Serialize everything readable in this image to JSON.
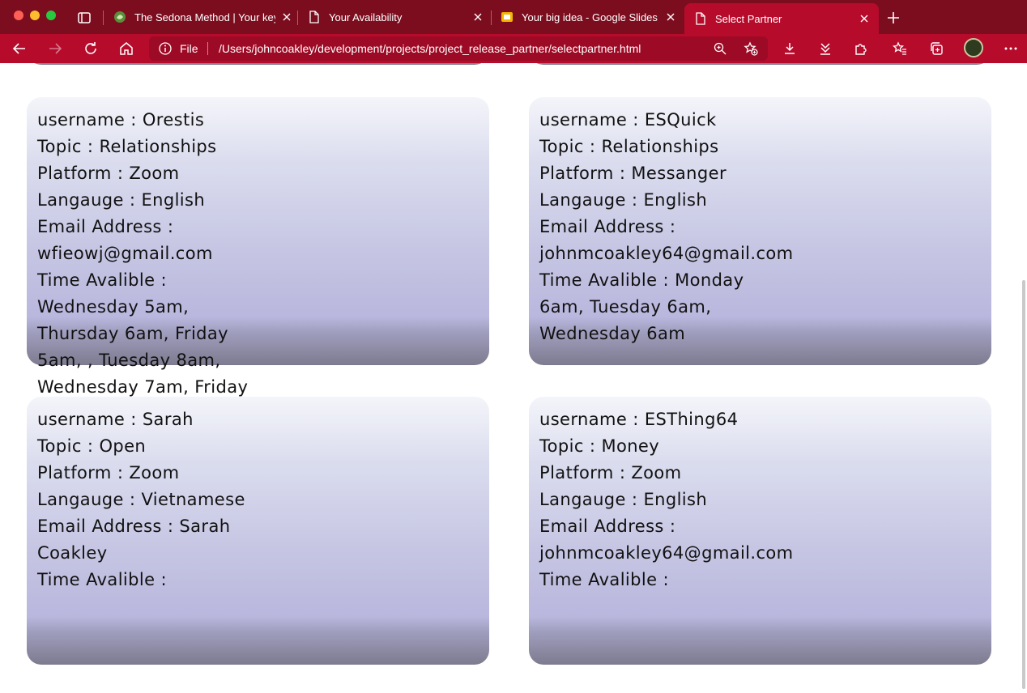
{
  "browser": {
    "tabs": [
      {
        "title": "The Sedona Method | Your key",
        "favicon": "globe-leaf-icon",
        "active": false
      },
      {
        "title": "Your Availability",
        "favicon": "page-icon",
        "active": false
      },
      {
        "title": "Your big idea - Google Slides",
        "favicon": "slides-icon",
        "active": false
      },
      {
        "title": "Select Partner",
        "favicon": "page-icon",
        "active": true
      }
    ],
    "address": {
      "scheme_label": "File",
      "url": "/Users/johncoakley/development/projects/project_release_partner/selectpartner.html"
    },
    "colors": {
      "tabbar": "#7c0d1f",
      "toolbar": "#b70b2c"
    }
  },
  "partners": [
    {
      "username": "Orestis",
      "topic": "Relationships",
      "platform": "Zoom",
      "language": "English",
      "email": "wfieowj@gmail.com",
      "time": "Wednesday 5am, Thursday 6am, Friday 5am, , Tuesday 8am, Wednesday 7am, Friday"
    },
    {
      "username": "ESQuick",
      "topic": "Relationships",
      "platform": "Messanger",
      "language": "English",
      "email": "johnmcoakley64@gmail.com",
      "time": "Monday 6am, Tuesday 6am, Wednesday 6am"
    },
    {
      "username": "Sarah",
      "topic": "Open",
      "platform": "Zoom",
      "language": "Vietnamese",
      "email": "Sarah Coakley",
      "time": ""
    },
    {
      "username": "ESThing64",
      "topic": "Money",
      "platform": "Zoom",
      "language": "English",
      "email": "johnmcoakley64@gmail.com",
      "time": ""
    }
  ],
  "labels": {
    "username": "username : ",
    "topic": "Topic : ",
    "platform": "Platform : ",
    "language": "Langauge : ",
    "email": "Email Address : ",
    "time": "Time Avalible : "
  }
}
